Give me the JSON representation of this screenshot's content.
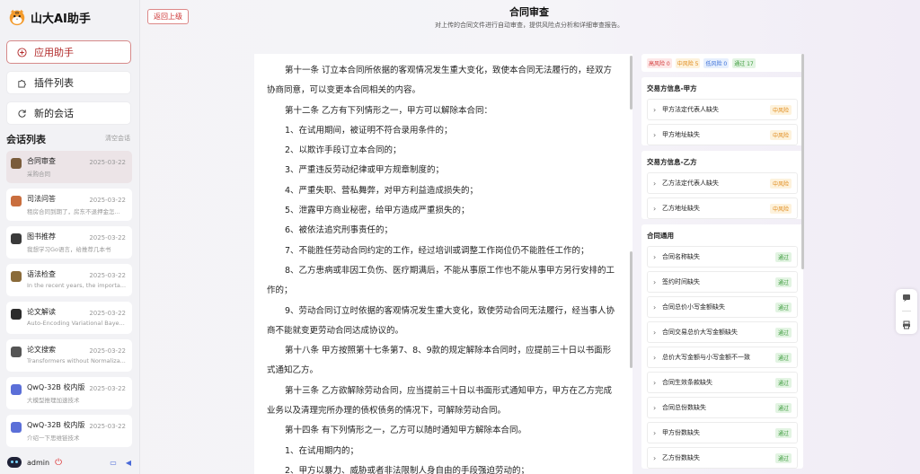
{
  "app": {
    "title": "山大AI助手",
    "nav": [
      {
        "label": "应用助手",
        "icon": "plus-circle-icon"
      },
      {
        "label": "插件列表",
        "icon": "puzzle-icon"
      },
      {
        "label": "新的会话",
        "icon": "refresh-icon"
      }
    ],
    "conversations_title": "会话列表",
    "clear_label": "清空会话",
    "conversations": [
      {
        "title": "合同审查",
        "date": "2025-03-22",
        "snippet": "采购合同"
      },
      {
        "title": "司法问答",
        "date": "2025-03-22",
        "snippet": "租房合同到期了，房东不退押金怎..."
      },
      {
        "title": "图书推荐",
        "date": "2025-03-22",
        "snippet": "我想学习Go语言，给推荐几本书"
      },
      {
        "title": "语法检查",
        "date": "2025-03-22",
        "snippet": "In the recent years, the importa..."
      },
      {
        "title": "论文解读",
        "date": "2025-03-22",
        "snippet": "Auto-Encoding Variational Baye..."
      },
      {
        "title": "论文搜索",
        "date": "2025-03-22",
        "snippet": "Transformers without Normaliza..."
      },
      {
        "title": "QwQ-32B 校内版",
        "date": "2025-03-22",
        "snippet": "大模型推理加速技术"
      },
      {
        "title": "QwQ-32B 校内版",
        "date": "2025-03-22",
        "snippet": "介绍一下思维链技术"
      }
    ],
    "user": "admin"
  },
  "header": {
    "back_label": "返回上级",
    "title": "合同审查",
    "subtitle": "对上传的合同文件进行自动审查，提供风险点分析和详细审查报告。"
  },
  "document": {
    "paragraphs": [
      {
        "text": "第十一条 订立本合同所依据的客观情况发生重大变化，致使本合同无法履行的，经双方协商同意，可以变更本合同相关的内容。",
        "indent": true
      },
      {
        "text": "第十二条 乙方有下列情形之一，甲方可以解除本合同：",
        "indent": true
      },
      {
        "text": "1、在试用期间，被证明不符合录用条件的；",
        "indent": true
      },
      {
        "text": "2、以欺诈手段订立本合同的；",
        "indent": true
      },
      {
        "text": "3、严重违反劳动纪律或甲方规章制度的；",
        "indent": true
      },
      {
        "text": "4、严重失职、营私舞弊，对甲方利益造成损失的；",
        "indent": true
      },
      {
        "text": "5、泄露甲方商业秘密，给甲方造成严重损失的；",
        "indent": true
      },
      {
        "text": "6、被依法追究刑事责任的；",
        "indent": true
      },
      {
        "text": "7、不能胜任劳动合同约定的工作，经过培训或调整工作岗位仍不能胜任工作的；",
        "indent": true
      },
      {
        "text": "8、乙方患病或非因工负伤、医疗期满后，不能从事原工作也不能从事甲方另行安排的工作的；",
        "indent": true
      },
      {
        "text": "9、劳动合同订立时依据的客观情况发生重大变化，致使劳动合同无法履行，经当事人协商不能就变更劳动合同达成协议的。",
        "indent": true
      },
      {
        "text": "第十八条 甲方按照第十七条第7、8、9款的规定解除本合同时，应提前三十日以书面形式通知乙方。",
        "indent": true
      },
      {
        "text": "第十三条 乙方欲解除劳动合同，应当提前三十日以书面形式通知甲方，甲方在乙方完成业务以及清理完所办理的债权债务的情况下，可解除劳动合同。",
        "indent": true
      },
      {
        "text": "第十四条 有下列情形之一，乙方可以随时通知甲方解除本合同。",
        "indent": true
      },
      {
        "text": "1、在试用期内的；",
        "indent": true
      },
      {
        "text": "2、甲方以暴力、威胁或者非法限制人身自由的手段强迫劳动的；",
        "indent": true
      }
    ]
  },
  "review": {
    "tags": [
      {
        "label": "高风险 0",
        "bg": "#fde8e8",
        "fg": "#d33b3b"
      },
      {
        "label": "中风险 5",
        "bg": "#fdf2dc",
        "fg": "#e08a1a"
      },
      {
        "label": "低风险 0",
        "bg": "#e6effd",
        "fg": "#3b6fd8"
      },
      {
        "label": "通过 17",
        "bg": "#e3f4e3",
        "fg": "#3a9a3a"
      }
    ],
    "groups": [
      {
        "title": "交易方信息-甲方",
        "items": [
          {
            "label": "甲方法定代表人缺失",
            "badge": "中风险",
            "level": "mid"
          },
          {
            "label": "甲方地址缺失",
            "badge": "中风险",
            "level": "mid"
          }
        ]
      },
      {
        "title": "交易方信息-乙方",
        "items": [
          {
            "label": "乙方法定代表人缺失",
            "badge": "中风险",
            "level": "mid"
          },
          {
            "label": "乙方地址缺失",
            "badge": "中风险",
            "level": "mid"
          }
        ]
      },
      {
        "title": "合同通用",
        "items": [
          {
            "label": "合同名称缺失",
            "badge": "通过",
            "level": "pass"
          },
          {
            "label": "签约时间缺失",
            "badge": "通过",
            "level": "pass"
          },
          {
            "label": "合同总价小写金额缺失",
            "badge": "通过",
            "level": "pass"
          },
          {
            "label": "合同交易总价大写金额缺失",
            "badge": "通过",
            "level": "pass"
          },
          {
            "label": "总价大写金额与小写金额不一致",
            "badge": "通过",
            "level": "pass"
          },
          {
            "label": "合同生效条款缺失",
            "badge": "通过",
            "level": "pass"
          },
          {
            "label": "合同总份数缺失",
            "badge": "通过",
            "level": "pass"
          },
          {
            "label": "甲方份数缺失",
            "badge": "通过",
            "level": "pass"
          },
          {
            "label": "乙方份数缺失",
            "badge": "通过",
            "level": "pass"
          }
        ]
      }
    ]
  }
}
